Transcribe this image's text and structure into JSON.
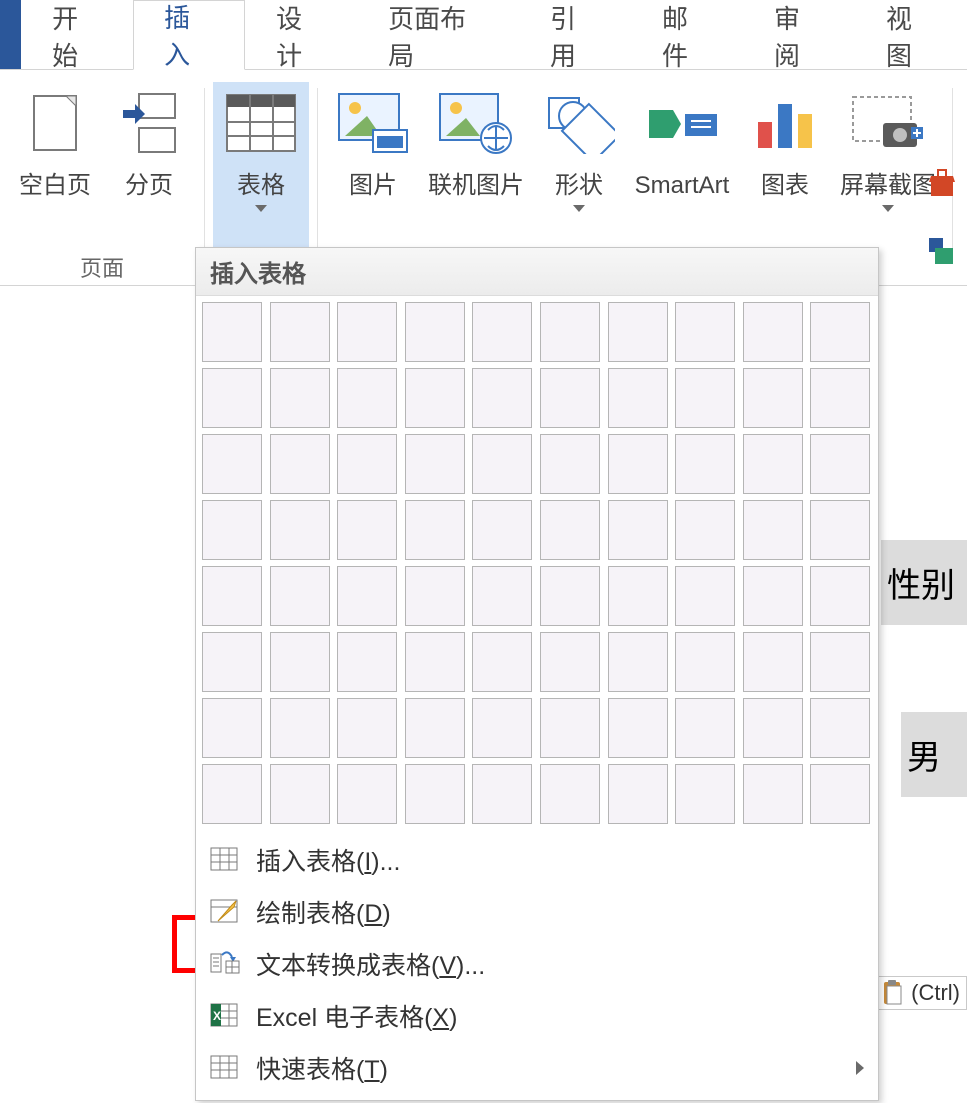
{
  "tabs": {
    "home": "开始",
    "insert": "插入",
    "design": "设计",
    "layout": "页面布局",
    "references": "引用",
    "mailings": "邮件",
    "review": "审阅",
    "view": "视图"
  },
  "groups": {
    "pages": "页面"
  },
  "cmds": {
    "blank_page": "空白页",
    "page_break": "分页",
    "table": "表格",
    "picture": "图片",
    "online_picture": "联机图片",
    "shapes": "形状",
    "smartart": "SmartArt",
    "chart": "图表",
    "screenshot": "屏幕截图"
  },
  "dropdown": {
    "title": "插入表格",
    "grid": {
      "cols": 10,
      "rows": 8
    },
    "items": {
      "insert_table": {
        "pre": "插入表格(",
        "accel": "I",
        "post": ")..."
      },
      "draw_table": {
        "pre": "绘制表格(",
        "accel": "D",
        "post": ")"
      },
      "text_to_table": {
        "pre": "文本转换成表格(",
        "accel": "V",
        "post": ")..."
      },
      "excel": {
        "pre": "Excel 电子表格(",
        "accel": "X",
        "post": ")"
      },
      "quick_table": {
        "pre": "快速表格(",
        "accel": "T",
        "post": ")"
      }
    }
  },
  "doc": {
    "cell_gender_header": "性别",
    "cell_gender_value": "男"
  },
  "paste_hint": "(Ctrl)"
}
